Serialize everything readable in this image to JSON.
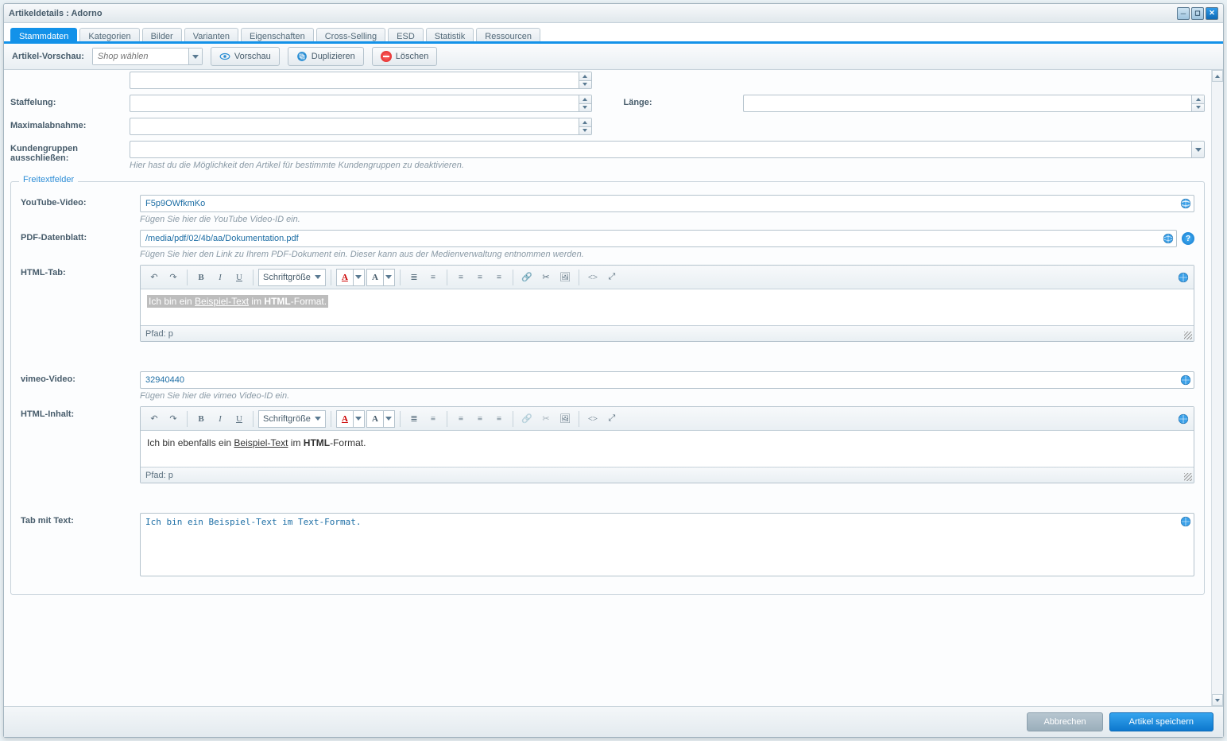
{
  "window": {
    "title": "Artikeldetails : Adorno"
  },
  "tabs": [
    "Stammdaten",
    "Kategorien",
    "Bilder",
    "Varianten",
    "Eigenschaften",
    "Cross-Selling",
    "ESD",
    "Statistik",
    "Ressourcen"
  ],
  "toolbar": {
    "label": "Artikel-Vorschau:",
    "shopPlaceholder": "Shop wählen",
    "preview": "Vorschau",
    "duplicate": "Duplizieren",
    "delete": "Löschen"
  },
  "form": {
    "staffelung": "Staffelung:",
    "maximalabnahme": "Maximalabnahme:",
    "laenge": "Länge:",
    "kundengruppen": "Kundengruppen ausschließen:",
    "kundengruppenHint": "Hier hast du die Möglichkeit den Artikel für bestimmte Kundengruppen zu deaktivieren."
  },
  "freitext": {
    "legend": "Freitextfelder",
    "youtube": {
      "label": "YouTube-Video:",
      "value": "F5p9OWfkmKo",
      "hint": "Fügen Sie hier die YouTube Video-ID ein."
    },
    "pdf": {
      "label": "PDF-Datenblatt:",
      "value": "/media/pdf/02/4b/aa/Dokumentation.pdf",
      "hint": "Fügen Sie hier den Link zu Ihrem PDF-Dokument ein. Dieser kann aus der Medienverwaltung entnommen werden."
    },
    "htmltab": {
      "label": "HTML-Tab:",
      "path": "Pfad: p",
      "content_pre": "Ich bin ein ",
      "content_u": "Beispiel-Text",
      "content_mid": " im ",
      "content_b": "HTML",
      "content_post": "-Format."
    },
    "vimeo": {
      "label": "vimeo-Video:",
      "value": "32940440",
      "hint": "Fügen Sie hier die vimeo Video-ID ein."
    },
    "htmlinhalt": {
      "label": "HTML-Inhalt:",
      "path": "Pfad: p",
      "content_pre": "Ich bin ebenfalls ein ",
      "content_u": "Beispiel-Text",
      "content_mid": " im ",
      "content_b": "HTML",
      "content_post": "-Format."
    },
    "tabtext": {
      "label": "Tab mit Text:",
      "value": "Ich bin ein Beispiel-Text im Text-Format."
    }
  },
  "editor": {
    "fontsize": "Schriftgröße"
  },
  "footer": {
    "cancel": "Abbrechen",
    "save": "Artikel speichern"
  }
}
